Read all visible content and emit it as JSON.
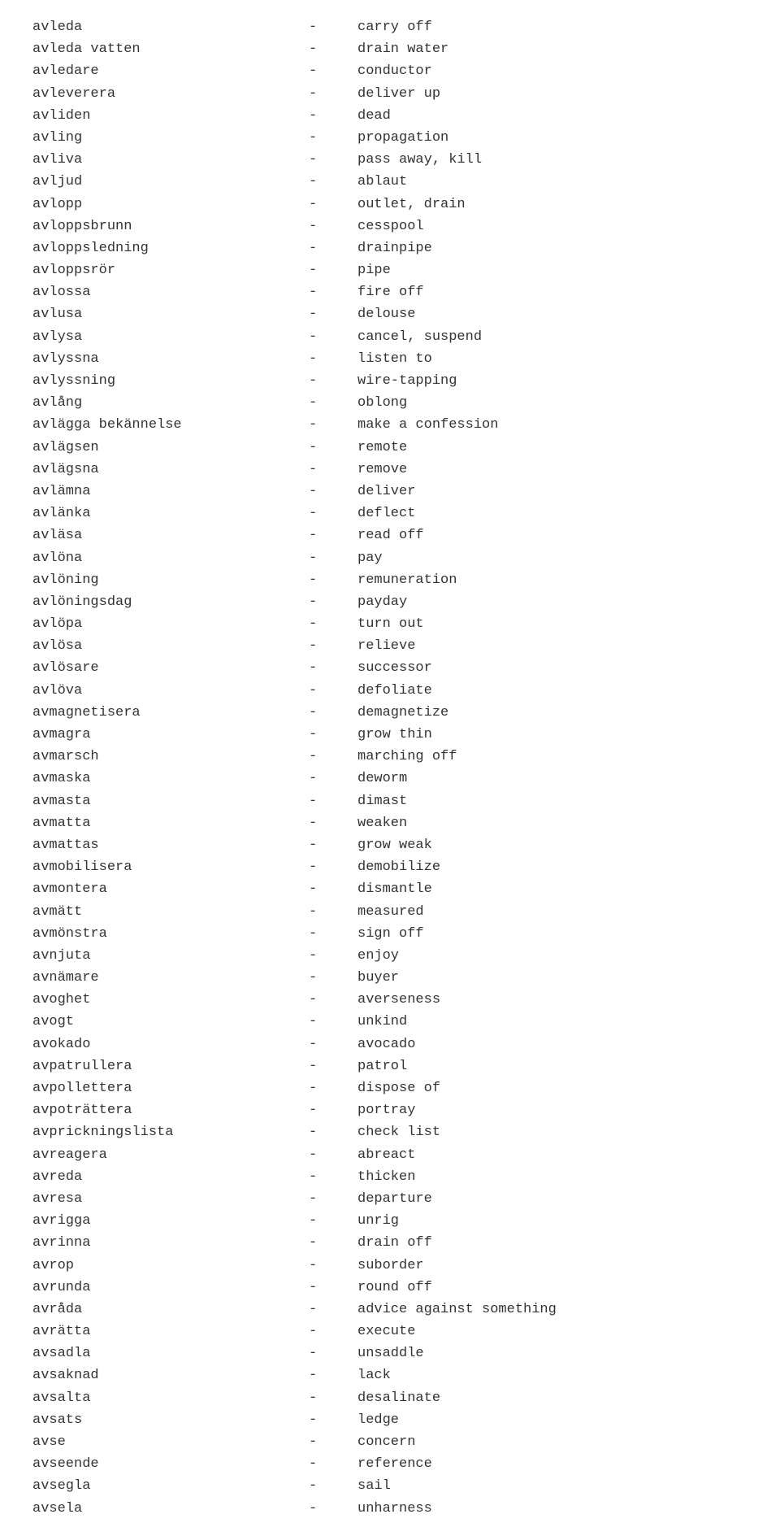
{
  "entries": [
    {
      "term": "avleda",
      "translation": "carry off"
    },
    {
      "term": "avleda vatten",
      "translation": "drain water"
    },
    {
      "term": "avledare",
      "translation": "conductor"
    },
    {
      "term": "avleverera",
      "translation": "deliver up"
    },
    {
      "term": "avliden",
      "translation": "dead"
    },
    {
      "term": "avling",
      "translation": "propagation"
    },
    {
      "term": "avliva",
      "translation": "pass away, kill"
    },
    {
      "term": "avljud",
      "translation": "ablaut"
    },
    {
      "term": "avlopp",
      "translation": "outlet, drain"
    },
    {
      "term": "avloppsbrunn",
      "translation": "cesspool"
    },
    {
      "term": "avloppsledning",
      "translation": "drainpipe"
    },
    {
      "term": "avloppsrör",
      "translation": "pipe"
    },
    {
      "term": "avlossa",
      "translation": "fire off"
    },
    {
      "term": "avlusa",
      "translation": "delouse"
    },
    {
      "term": "avlysa",
      "translation": "cancel, suspend"
    },
    {
      "term": "avlyssna",
      "translation": "listen to"
    },
    {
      "term": "avlyssning",
      "translation": "wire-tapping"
    },
    {
      "term": "avlång",
      "translation": "oblong"
    },
    {
      "term": "avlägga bekännelse",
      "translation": "make a confession"
    },
    {
      "term": "avlägsen",
      "translation": "remote"
    },
    {
      "term": "avlägsna",
      "translation": "remove"
    },
    {
      "term": "avlämna",
      "translation": "deliver"
    },
    {
      "term": "avlänka",
      "translation": "deflect"
    },
    {
      "term": "avläsa",
      "translation": "read off"
    },
    {
      "term": "avlöna",
      "translation": "pay"
    },
    {
      "term": "avlöning",
      "translation": "remuneration"
    },
    {
      "term": "avlöningsdag",
      "translation": "payday"
    },
    {
      "term": "avlöpa",
      "translation": "turn out"
    },
    {
      "term": "avlösa",
      "translation": "relieve"
    },
    {
      "term": "avlösare",
      "translation": "successor"
    },
    {
      "term": "avlöva",
      "translation": "defoliate"
    },
    {
      "term": "avmagnetisera",
      "translation": "demagnetize"
    },
    {
      "term": "avmagra",
      "translation": "grow thin"
    },
    {
      "term": "avmarsch",
      "translation": "marching off"
    },
    {
      "term": "avmaska",
      "translation": "deworm"
    },
    {
      "term": "avmasta",
      "translation": "dimast"
    },
    {
      "term": "avmatta",
      "translation": "weaken"
    },
    {
      "term": "avmattas",
      "translation": "grow weak"
    },
    {
      "term": "avmobilisera",
      "translation": "demobilize"
    },
    {
      "term": "avmontera",
      "translation": "dismantle"
    },
    {
      "term": "avmätt",
      "translation": "measured"
    },
    {
      "term": "avmönstra",
      "translation": "sign off"
    },
    {
      "term": "avnjuta",
      "translation": "enjoy"
    },
    {
      "term": "avnämare",
      "translation": "buyer"
    },
    {
      "term": "avoghet",
      "translation": "averseness"
    },
    {
      "term": "avogt",
      "translation": "unkind"
    },
    {
      "term": "avokado",
      "translation": "avocado"
    },
    {
      "term": "avpatrullera",
      "translation": "patrol"
    },
    {
      "term": "avpollettera",
      "translation": "dispose of"
    },
    {
      "term": "avpoträttera",
      "translation": "portray"
    },
    {
      "term": "avprickningslista",
      "translation": "check list"
    },
    {
      "term": "avreagera",
      "translation": "abreact"
    },
    {
      "term": "avreda",
      "translation": "thicken"
    },
    {
      "term": "avresa",
      "translation": "departure"
    },
    {
      "term": "avrigga",
      "translation": "unrig"
    },
    {
      "term": "avrinna",
      "translation": "drain off"
    },
    {
      "term": "avrop",
      "translation": "suborder"
    },
    {
      "term": "avrunda",
      "translation": "round off"
    },
    {
      "term": "avråda",
      "translation": "advice against something"
    },
    {
      "term": "avrätta",
      "translation": "execute"
    },
    {
      "term": "avsadla",
      "translation": "unsaddle"
    },
    {
      "term": "avsaknad",
      "translation": "lack"
    },
    {
      "term": "avsalta",
      "translation": "desalinate"
    },
    {
      "term": "avsats",
      "translation": "ledge"
    },
    {
      "term": "avse",
      "translation": "concern"
    },
    {
      "term": "avseende",
      "translation": "reference"
    },
    {
      "term": "avsegla",
      "translation": "sail"
    },
    {
      "term": "avsela",
      "translation": "unharness"
    }
  ]
}
